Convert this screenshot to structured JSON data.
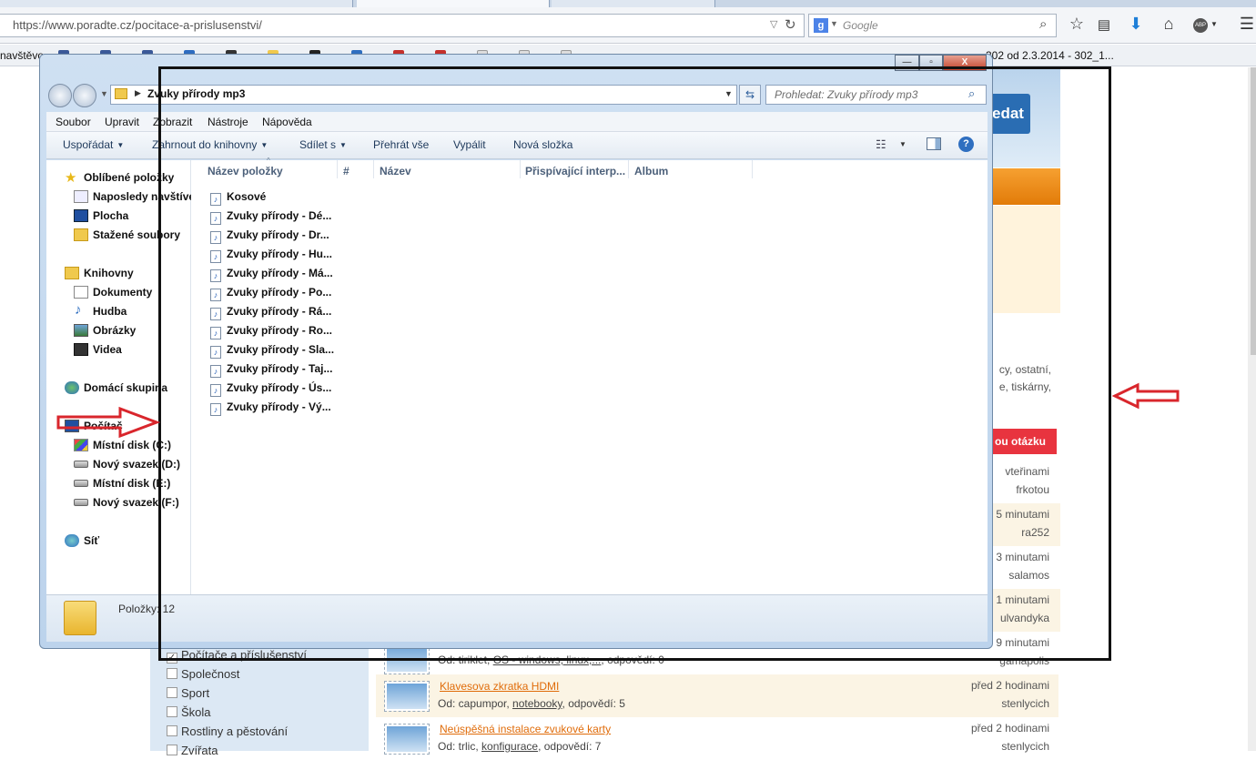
{
  "browser": {
    "url": "https://www.poradte.cz/pocitace-a-prislusenstvi/",
    "search_engine_letter": "g",
    "search_placeholder": "Google",
    "bookmarks_first": "navštěvo",
    "bookmarks_last": "302 od 2.3.2014 - 302_1...",
    "icons": [
      "star-icon",
      "reading-list-icon",
      "download-icon",
      "home-icon",
      "adblock-icon",
      "menu-icon"
    ],
    "adblock_label": "ABP"
  },
  "page": {
    "search_button": "edat",
    "categories_text": [
      "cy, ostatní,",
      "e, tiskárny,"
    ],
    "ask_button": "ou otázku",
    "right_times": [
      {
        "time": "vteřinami",
        "user": "frkotou"
      },
      {
        "time": "5 minutami",
        "user": "ra252"
      },
      {
        "time": "3 minutami",
        "user": "salamos"
      },
      {
        "time": "1 minutami",
        "user": "ulvandyka"
      },
      {
        "time": "9 minutami",
        "user": "gamapolis"
      }
    ],
    "left_categories": [
      {
        "label": "Počítače a příslušenství",
        "checked": true
      },
      {
        "label": "Společnost",
        "checked": false
      },
      {
        "label": "Sport",
        "checked": false
      },
      {
        "label": "Škola",
        "checked": false
      },
      {
        "label": "Rostliny a pěstování",
        "checked": false
      },
      {
        "label": "Zvířata",
        "checked": false
      }
    ],
    "questions": [
      {
        "title": "",
        "meta_prefix": "Od: tiriklet, ",
        "meta_link": "OS - windows, linux,...",
        "meta_suffix": ", odpovědí: 0",
        "time": "",
        "user": ""
      },
      {
        "title": "Klavesova zkratka HDMI",
        "meta_prefix": "Od: capumpor, ",
        "meta_link": "notebooky",
        "meta_suffix": ", odpovědí: 5",
        "time": "před 2 hodinami",
        "user": "stenlycich"
      },
      {
        "title": "Neúspěšná instalace zvukové karty",
        "meta_prefix": "Od: trlic, ",
        "meta_link": "konfigurace",
        "meta_suffix": ", odpovědí: 7",
        "time": "před 2 hodinami",
        "user": "stenlycich"
      }
    ]
  },
  "explorer": {
    "address": "Zvuky přírody mp3",
    "search_placeholder": "Prohledat: Zvuky přírody mp3",
    "window_buttons": {
      "min": "—",
      "max": "▫",
      "close": "X"
    },
    "menu": [
      "Soubor",
      "Upravit",
      "Zobrazit",
      "Nástroje",
      "Nápověda"
    ],
    "commands": [
      {
        "label": "Uspořádat",
        "dropdown": true
      },
      {
        "label": "Zahrnout do knihovny",
        "dropdown": true
      },
      {
        "label": "Sdílet s",
        "dropdown": true
      },
      {
        "label": "Přehrát vše",
        "dropdown": false
      },
      {
        "label": "Vypálit",
        "dropdown": false
      },
      {
        "label": "Nová složka",
        "dropdown": false
      }
    ],
    "nav": {
      "favorites": "Oblíbené položky",
      "favorites_items": [
        "Naposledy navštívené",
        "Plocha",
        "Stažené soubory"
      ],
      "libraries": "Knihovny",
      "libraries_items": [
        "Dokumenty",
        "Hudba",
        "Obrázky",
        "Videa"
      ],
      "homegroup": "Domácí skupina",
      "computer": "Počítač",
      "drives": [
        "Místní disk (C:)",
        "Nový svazek (D:)",
        "Místní disk (E:)",
        "Nový svazek (F:)"
      ],
      "network": "Síť"
    },
    "columns": [
      "Název položky",
      "#",
      "Název",
      "Přispívající interp...",
      "Album"
    ],
    "files": [
      "Kosové",
      "Zvuky přírody - Dé...",
      "Zvuky přírody - Dr...",
      "Zvuky přírody - Hu...",
      "Zvuky přírody - Má...",
      "Zvuky přírody - Po...",
      "Zvuky přírody - Rá...",
      "Zvuky přírody - Ro...",
      "Zvuky přírody - Sla...",
      "Zvuky přírody - Taj...",
      "Zvuky přírody - Ús...",
      "Zvuky přírody - Vý..."
    ],
    "status": "Položky: 12"
  },
  "colors": {
    "annotation_arrow": "#d9262c",
    "annotation_frame": "#111111",
    "accent_blue": "#2a6db3",
    "orange": "#e27b08"
  }
}
